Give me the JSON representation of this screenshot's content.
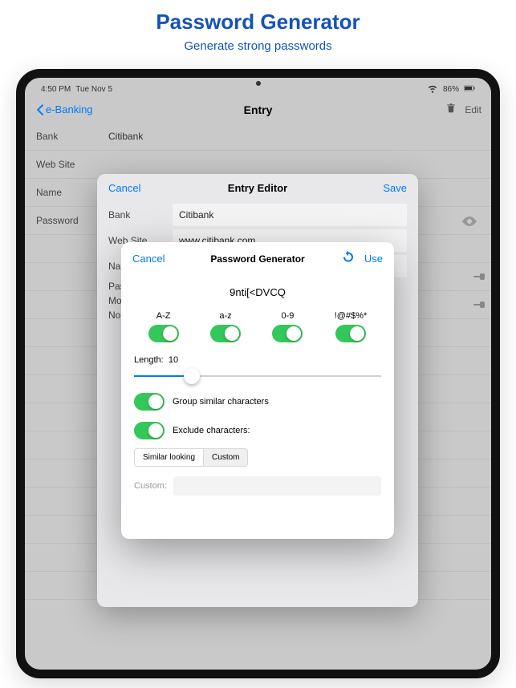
{
  "promo": {
    "title": "Password Generator",
    "subtitle": "Generate strong passwords"
  },
  "statusbar": {
    "time": "4:50 PM",
    "date": "Tue Nov 5",
    "battery": "86%"
  },
  "nav": {
    "back": "e-Banking",
    "title": "Entry",
    "edit": "Edit"
  },
  "entry": {
    "rows": [
      {
        "label": "Bank",
        "value": "Citibank"
      },
      {
        "label": "Web Site",
        "value": ""
      },
      {
        "label": "Name",
        "value": ""
      },
      {
        "label": "Password",
        "value": ""
      }
    ]
  },
  "editor": {
    "cancel": "Cancel",
    "title": "Entry Editor",
    "save": "Save",
    "fields": {
      "bank_label": "Bank",
      "bank_value": "Citibank",
      "website_label": "Web Site",
      "website_value": "www.citibank.com",
      "name_label": "Name",
      "name_value": "",
      "pass_label": "Pas",
      "more_label": "Mo",
      "notes_label": "No"
    }
  },
  "generator": {
    "cancel": "Cancel",
    "title": "Password Generator",
    "use": "Use",
    "password": "9nti[<DVCQ",
    "opts": {
      "upper": "A-Z",
      "lower": "a-z",
      "digits": "0-9",
      "symbols": "!@#$%*"
    },
    "length_label": "Length:",
    "length_value": "10",
    "group_label": "Group similar characters",
    "exclude_label": "Exclude characters:",
    "seg": {
      "similar": "Similar looking",
      "custom": "Custom"
    },
    "custom_label": "Custom:"
  }
}
